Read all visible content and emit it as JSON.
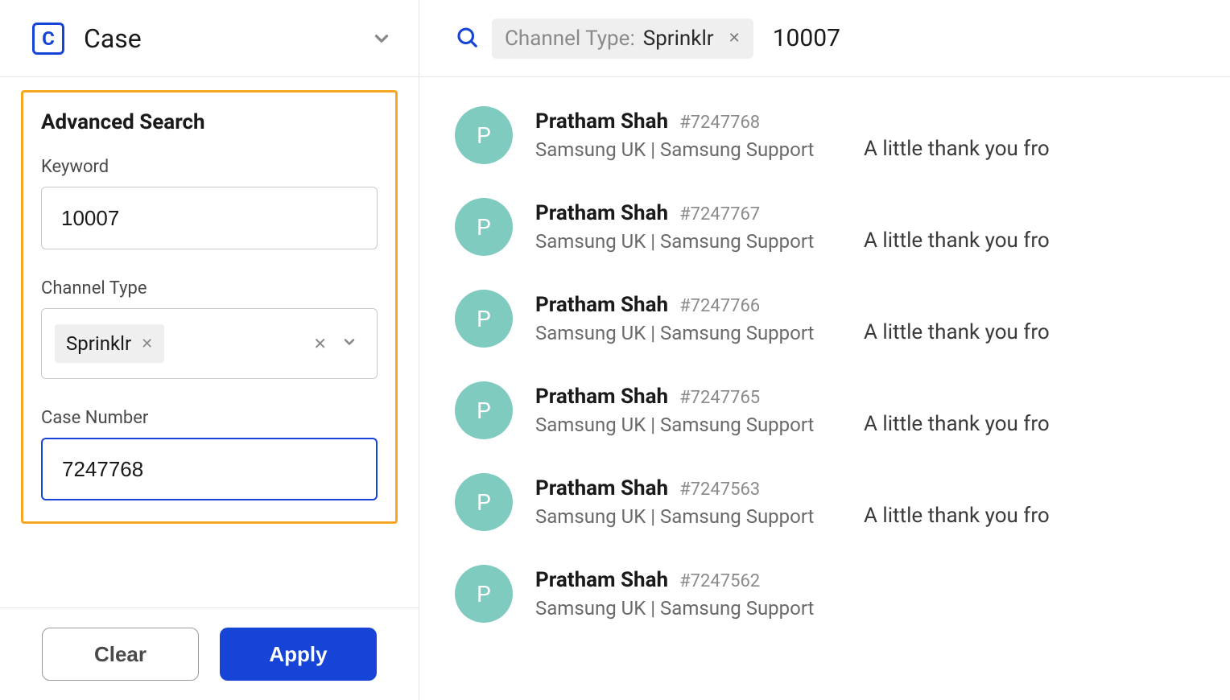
{
  "selector": {
    "icon_letter": "C",
    "label": "Case"
  },
  "advanced_search": {
    "title": "Advanced Search",
    "keyword_label": "Keyword",
    "keyword_value": "10007",
    "channel_type_label": "Channel Type",
    "channel_type_chip": "Sprinklr",
    "case_number_label": "Case Number",
    "case_number_value": "7247768"
  },
  "footer": {
    "clear_label": "Clear",
    "apply_label": "Apply"
  },
  "search_bar": {
    "chip_label": "Channel Type:",
    "chip_value": "Sprinklr",
    "query_text": "10007"
  },
  "results": [
    {
      "avatar_letter": "P",
      "name": "Pratham Shah",
      "id": "#7247768",
      "sub": "Samsung UK | Samsung Support",
      "snippet": "A little thank you fro"
    },
    {
      "avatar_letter": "P",
      "name": "Pratham Shah",
      "id": "#7247767",
      "sub": "Samsung UK | Samsung Support",
      "snippet": "A little thank you fro"
    },
    {
      "avatar_letter": "P",
      "name": "Pratham Shah",
      "id": "#7247766",
      "sub": "Samsung UK | Samsung Support",
      "snippet": "A little thank you fro"
    },
    {
      "avatar_letter": "P",
      "name": "Pratham Shah",
      "id": "#7247765",
      "sub": "Samsung UK | Samsung Support",
      "snippet": "A little thank you fro"
    },
    {
      "avatar_letter": "P",
      "name": "Pratham Shah",
      "id": "#7247563",
      "sub": "Samsung UK | Samsung Support",
      "snippet": "A little thank you fro"
    },
    {
      "avatar_letter": "P",
      "name": "Pratham Shah",
      "id": "#7247562",
      "sub": "Samsung UK | Samsung Support",
      "snippet": ""
    }
  ]
}
